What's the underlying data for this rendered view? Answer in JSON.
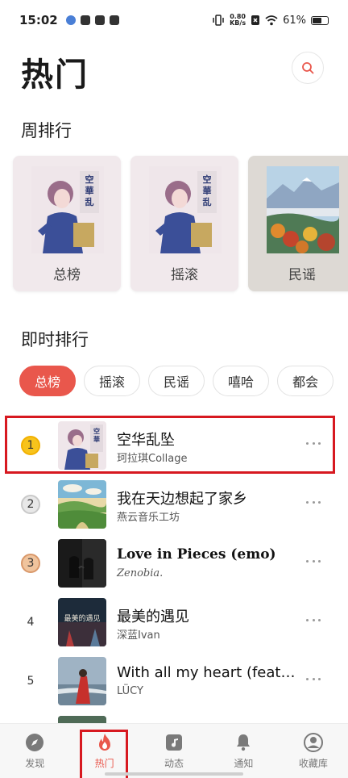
{
  "status_bar": {
    "time": "15:02",
    "net_speed_value": "0.80",
    "net_speed_unit": "KB/s",
    "battery": "61%"
  },
  "header": {
    "title": "热门",
    "search_icon": "search-icon"
  },
  "weekly": {
    "title": "周排行",
    "cards": [
      {
        "label": "总榜",
        "art": "anime-album-art"
      },
      {
        "label": "摇滚",
        "art": "anime-album-art"
      },
      {
        "label": "民谣",
        "art": "landscape-painting"
      }
    ]
  },
  "realtime": {
    "title": "即时排行",
    "chips": [
      "总榜",
      "摇滚",
      "民谣",
      "嘻哈",
      "都会"
    ],
    "active_chip": "总榜"
  },
  "songs": [
    {
      "rank": "1",
      "title": "空华乱坠",
      "artist": "珂拉琪Collage",
      "highlighted": true
    },
    {
      "rank": "2",
      "title": "我在天边想起了家乡",
      "artist": "燕云音乐工坊"
    },
    {
      "rank": "3",
      "title": "Love in Pieces (emo)",
      "artist": "Zenobia."
    },
    {
      "rank": "4",
      "title": "最美的遇见",
      "artist": "深蓝Ivan"
    },
    {
      "rank": "5",
      "title": "With all my heart (feat…",
      "artist": "LÜCY"
    }
  ],
  "nav": {
    "items": [
      {
        "label": "发现",
        "icon": "compass-icon"
      },
      {
        "label": "热门",
        "icon": "fire-icon"
      },
      {
        "label": "动态",
        "icon": "music-note-icon"
      },
      {
        "label": "通知",
        "icon": "bell-icon"
      },
      {
        "label": "收藏库",
        "icon": "user-icon"
      }
    ],
    "active": "热门"
  },
  "colors": {
    "accent": "#e9574c",
    "highlight_box": "#d71920"
  }
}
